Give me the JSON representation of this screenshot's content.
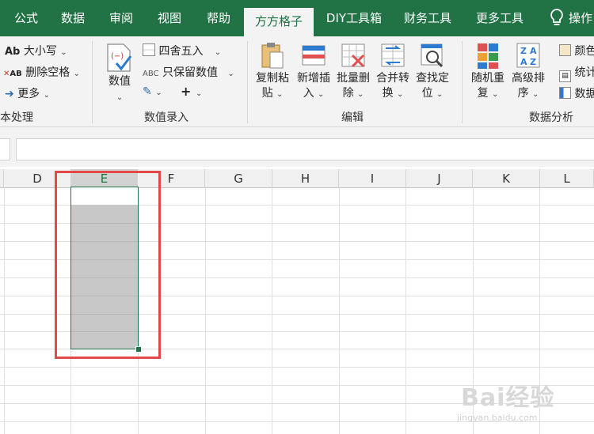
{
  "tabs": [
    {
      "label": "公式",
      "active": false
    },
    {
      "label": "数据",
      "active": false
    },
    {
      "label": "审阅",
      "active": false
    },
    {
      "label": "视图",
      "active": false
    },
    {
      "label": "帮助",
      "active": false
    },
    {
      "label": "方方格子",
      "active": true
    },
    {
      "label": "DIY工具箱",
      "active": false
    },
    {
      "label": "财务工具",
      "active": false
    },
    {
      "label": "更多工具",
      "active": false
    },
    {
      "label": "操作",
      "active": false
    }
  ],
  "ribbon": {
    "text_group": {
      "case_label": "大小写",
      "delete_space_label": "删除空格",
      "more_label": "更多",
      "group_label": "本处理"
    },
    "number_group": {
      "value_label": "数值",
      "round_label": "四舍五入",
      "keep_value_label": "只保留数值",
      "abc_prefix": "ABC",
      "group_label": "数值录入"
    },
    "edit_group": {
      "copy_paste": [
        "复制粘",
        "贴"
      ],
      "new_insert": [
        "新增插",
        "入"
      ],
      "batch_delete": [
        "批量删",
        "除"
      ],
      "merge_convert": [
        "合并转",
        "换"
      ],
      "find_locate": [
        "查找定",
        "位"
      ],
      "group_label": "编辑"
    },
    "analysis_group": {
      "random_dup": [
        "随机重",
        "复"
      ],
      "advanced_sort": [
        "高级排",
        "序"
      ],
      "color_label": "颜色",
      "stats_label": "统计",
      "data_label": "数据",
      "group_label": "数据分析"
    }
  },
  "grid": {
    "columns": [
      "D",
      "E",
      "F",
      "G",
      "H",
      "I",
      "J",
      "K",
      "L"
    ],
    "selected_column": "E"
  },
  "watermark": {
    "brand": "Bai经验",
    "url": "jingyan.baidu.com"
  },
  "colors": {
    "accent": "#217346",
    "selection_shade": "#c8c8c8",
    "highlight_box": "#e24a4a"
  }
}
